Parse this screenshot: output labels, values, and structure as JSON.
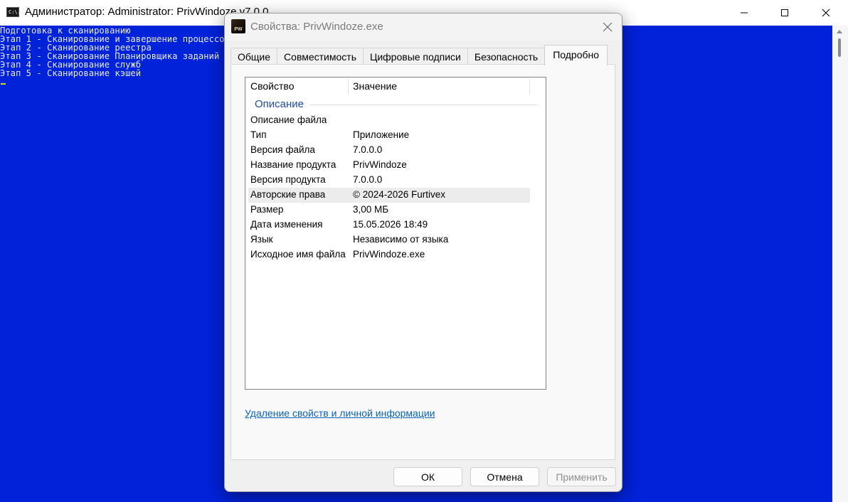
{
  "console": {
    "icon_text": "C:\\.",
    "title": "Администратор: Administrator:  PrivWindoze v7.0.0",
    "lines": [
      "Подготовка к сканированию",
      "Этап 1 - Сканирование и завершение процессов",
      "Этап 2 - Сканирование реестра",
      "Этап 3 - Сканирование Планировщика заданий",
      "Этап 4 - Сканирование служб",
      "Этап 5 - Сканирование кэшей"
    ]
  },
  "dialog": {
    "icon_text": "PW",
    "title": "Свойства: PrivWindoze.exe",
    "tabs": [
      "Общие",
      "Совместимость",
      "Цифровые подписи",
      "Безопасность",
      "Подробно"
    ],
    "active_tab": "Подробно",
    "columns": {
      "property": "Свойство",
      "value": "Значение"
    },
    "group": "Описание",
    "rows": [
      {
        "name": "Описание файла",
        "value": ""
      },
      {
        "name": "Тип",
        "value": "Приложение"
      },
      {
        "name": "Версия файла",
        "value": "7.0.0.0"
      },
      {
        "name": "Название продукта",
        "value": "PrivWindoze"
      },
      {
        "name": "Версия продукта",
        "value": "7.0.0.0"
      },
      {
        "name": "Авторские права",
        "value": "© 2024-2026 Furtivex"
      },
      {
        "name": "Размер",
        "value": "3,00 МБ"
      },
      {
        "name": "Дата изменения",
        "value": "15.05.2026 18:49"
      },
      {
        "name": "Язык",
        "value": "Независимо от языка"
      },
      {
        "name": "Исходное имя файла",
        "value": "PrivWindoze.exe"
      }
    ],
    "selected_row": "Авторские права",
    "remove_link": "Удаление свойств и личной информации",
    "buttons": {
      "ok": "ОК",
      "cancel": "Отмена",
      "apply": "Применить"
    }
  },
  "colors": {
    "console_bg": "#0022d8",
    "console_text": "#e8e8e8",
    "cursor": "#c8e000",
    "link": "#0b62b8",
    "group_label": "#1f4ea3"
  }
}
